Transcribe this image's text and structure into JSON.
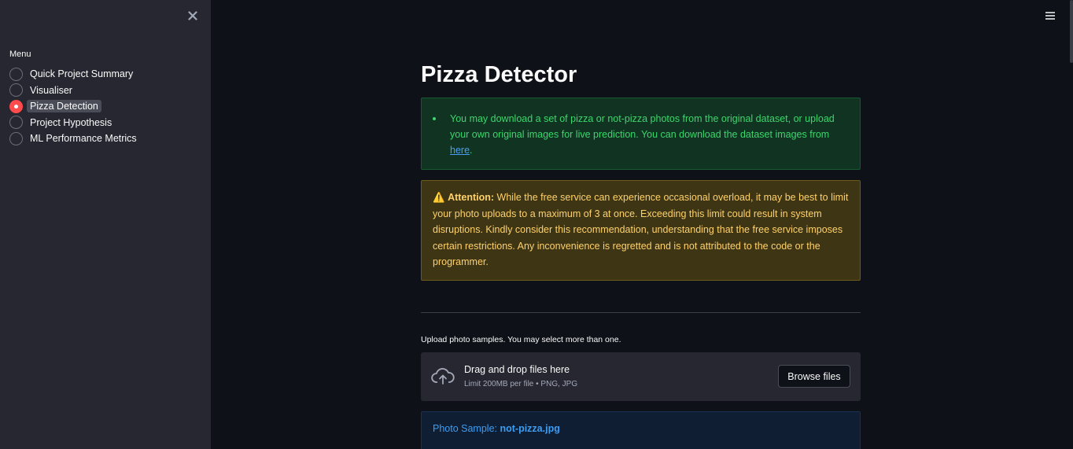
{
  "sidebar": {
    "menu_label": "Menu",
    "items": [
      {
        "label": "Quick Project Summary"
      },
      {
        "label": "Visualiser"
      },
      {
        "label": "Pizza Detection"
      },
      {
        "label": "Project Hypothesis"
      },
      {
        "label": "ML Performance Metrics"
      }
    ],
    "selected": "Pizza Detection"
  },
  "main": {
    "title": "Pizza Detector",
    "info": {
      "text_before_link": "You may download a set of pizza or not-pizza photos from the original dataset, or upload your own original images for live prediction. You can download the dataset images from ",
      "link_text": "here",
      "text_after_link": "."
    },
    "warning": {
      "icon": "⚠️",
      "heading": "Attention:",
      "text": " While the free service can experience occasional overload, it may be best to limit your photo uploads to a maximum of 3 at once. Exceeding this limit could result in system disruptions. Kindly consider this recommendation, understanding that the free service imposes certain restrictions. Any inconvenience is regretted and is not attributed to the code or the programmer."
    },
    "uploader": {
      "label": "Upload photo samples. You may select more than one.",
      "drop_title": "Drag and drop files here",
      "drop_sub": "Limit 200MB per file • PNG, JPG",
      "browse_label": "Browse files"
    },
    "sample": {
      "prefix": "Photo Sample: ",
      "filename": "not-pizza.jpg"
    }
  },
  "colors": {
    "background": "#0e1117",
    "sidebar": "#262730",
    "accent": "#ff4b4b",
    "success_text": "#3dd56d",
    "warning_text": "#ffd16a",
    "info_text": "#3d9df3"
  }
}
